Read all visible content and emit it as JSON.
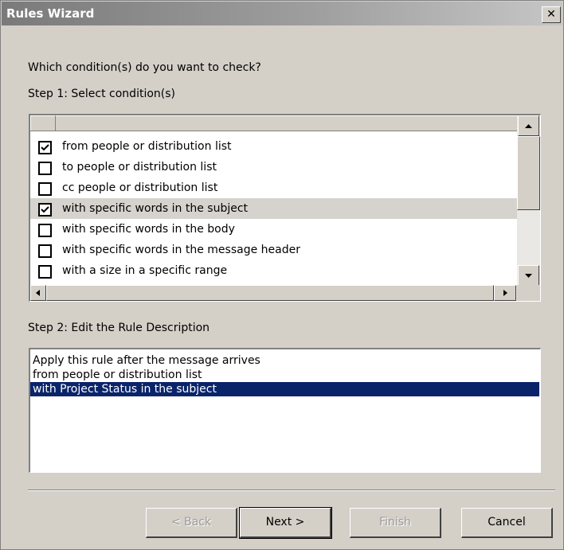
{
  "window": {
    "title": "Rules Wizard",
    "close_glyph": "✕"
  },
  "prompt": "Which condition(s) do you want to check?",
  "step1_label": "Step 1: Select condition(s)",
  "conditions": [
    {
      "label": "from people or distribution list",
      "checked": true
    },
    {
      "label": "to people or distribution list",
      "checked": false
    },
    {
      "label": "cc people or distribution list",
      "checked": false
    },
    {
      "label": "with specific words in the subject",
      "checked": true,
      "selected": true
    },
    {
      "label": "with specific words in the body",
      "checked": false
    },
    {
      "label": "with specific words in the message header",
      "checked": false
    },
    {
      "label": "with a size in a specific range",
      "checked": false
    }
  ],
  "step2_label": "Step 2: Edit the Rule Description",
  "description_lines": [
    "Apply this rule after the message arrives",
    "from people or distribution list",
    "with Project Status in the subject"
  ],
  "buttons": {
    "back": "< Back",
    "next": "Next >",
    "finish": "Finish",
    "cancel": "Cancel"
  },
  "colors": {
    "dialog_bg": "#d4d0c8",
    "highlight": "#0a246a",
    "selected_row": "#d6d3ce"
  }
}
